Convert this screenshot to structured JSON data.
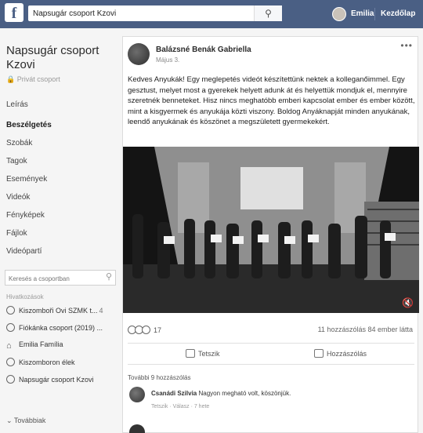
{
  "topbar": {
    "logo": "f",
    "search_value": "Napsugár csoport Kzovi",
    "search_icon": "search-icon",
    "user_name": "Emilia",
    "home_label": "Kezdőlap"
  },
  "sidebar": {
    "group_name": "Napsugár csoport Kzovi",
    "privacy": "Privát csoport",
    "nav": [
      {
        "label": "Leírás"
      },
      {
        "label": "Beszélgetés"
      },
      {
        "label": "Szobák"
      },
      {
        "label": "Tagok"
      },
      {
        "label": "Események"
      },
      {
        "label": "Videók"
      },
      {
        "label": "Fényképek"
      },
      {
        "label": "Fájlok"
      },
      {
        "label": "Videópartí"
      }
    ],
    "search_placeholder": "Keresés a csoportban",
    "shortcuts_title": "Hivatkozások",
    "shortcuts": [
      {
        "label": "Kiszomboři Ovi SZMK t...",
        "badge": "4"
      },
      {
        "label": "Fiókánka csoport (2019) ...",
        "badge": ""
      },
      {
        "label": "Emilia Família",
        "badge": ""
      },
      {
        "label": "Kiszomboron élek",
        "badge": ""
      },
      {
        "label": "Napsugár csoport Kzovi",
        "badge": ""
      }
    ],
    "more_label": "Továbbiak"
  },
  "post": {
    "author": "Balázsné Benák Gabriella",
    "date": "Május 3.",
    "text": "Kedves Anyukák! Egy meglepetés videót készítettünk nektek a kolleganőimmel. Egy gesztust, melyet most a gyerekek helyett adunk át és helyettük mondjuk el, mennyire szeretnék benneteket. Hisz nincs meghatóbb emberi kapcsolat ember és ember között, mint a kisgyermek és anyukája közti viszony. Boldog Anyáknapját minden anyukának, leendő anyukának és köszönet a megszületett gyermekekért.",
    "reaction_count": "17",
    "comment_share": "11 hozzászólás  84 ember látta",
    "like_label": "Tetszik",
    "comment_label": "Hozzászólás",
    "more_comments": "További 9 hozzászólás",
    "comment": {
      "author": "Csanádi Szilvia",
      "text": "Nagyon megható volt, köszönjük.",
      "meta": "Tetszik · Válasz · 7 hete"
    }
  }
}
